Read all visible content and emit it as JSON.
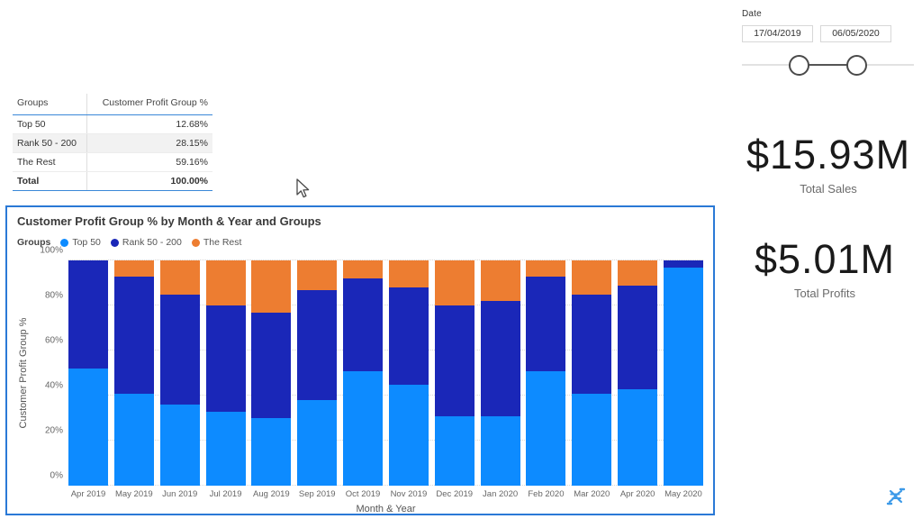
{
  "slicer": {
    "title": "Date",
    "start_value": "17/04/2019",
    "end_value": "06/05/2020"
  },
  "table": {
    "headers": [
      "Groups",
      "Customer Profit Group %"
    ],
    "rows": [
      {
        "group": "Top 50",
        "value": "12.68%"
      },
      {
        "group": "Rank 50 - 200",
        "value": "28.15%"
      },
      {
        "group": "The Rest",
        "value": "59.16%"
      }
    ],
    "total": {
      "group": "Total",
      "value": "100.00%"
    }
  },
  "kpis": [
    {
      "value": "$15.93M",
      "label": "Total Sales"
    },
    {
      "value": "$5.01M",
      "label": "Total Profits"
    }
  ],
  "chart_data": {
    "type": "bar",
    "stacked": true,
    "stack_mode": "percent",
    "title": "Customer Profit Group % by Month & Year and Groups",
    "legend_title": "Groups",
    "legend_position": "top-left",
    "xlabel": "Month & Year",
    "ylabel": "Customer Profit Group %",
    "ylim": [
      0,
      100
    ],
    "yticks": [
      0,
      20,
      40,
      60,
      80,
      100
    ],
    "ytick_labels": [
      "0%",
      "20%",
      "40%",
      "60%",
      "80%",
      "100%"
    ],
    "grid": true,
    "categories": [
      "Apr 2019",
      "May 2019",
      "Jun 2019",
      "Jul 2019",
      "Aug 2019",
      "Sep 2019",
      "Oct 2019",
      "Nov 2019",
      "Dec 2019",
      "Jan 2020",
      "Feb 2020",
      "Mar 2020",
      "Apr 2020",
      "May 2020"
    ],
    "series": [
      {
        "name": "Top 50",
        "color": "#0D8BFF",
        "values": [
          52,
          41,
          36,
          33,
          30,
          38,
          51,
          45,
          31,
          31,
          51,
          41,
          43,
          97
        ]
      },
      {
        "name": "Rank 50 - 200",
        "color": "#1A27B8",
        "values": [
          48,
          52,
          49,
          47,
          47,
          49,
          41,
          43,
          49,
          51,
          42,
          44,
          46,
          3
        ]
      },
      {
        "name": "The Rest",
        "color": "#ED7D31",
        "values": [
          0,
          7,
          15,
          20,
          23,
          13,
          8,
          12,
          20,
          18,
          7,
          15,
          11,
          0
        ]
      }
    ]
  },
  "icons": {
    "cursor": "mouse-pointer-icon",
    "logo": "helix-logo-icon"
  },
  "logo": {
    "caption": ""
  }
}
